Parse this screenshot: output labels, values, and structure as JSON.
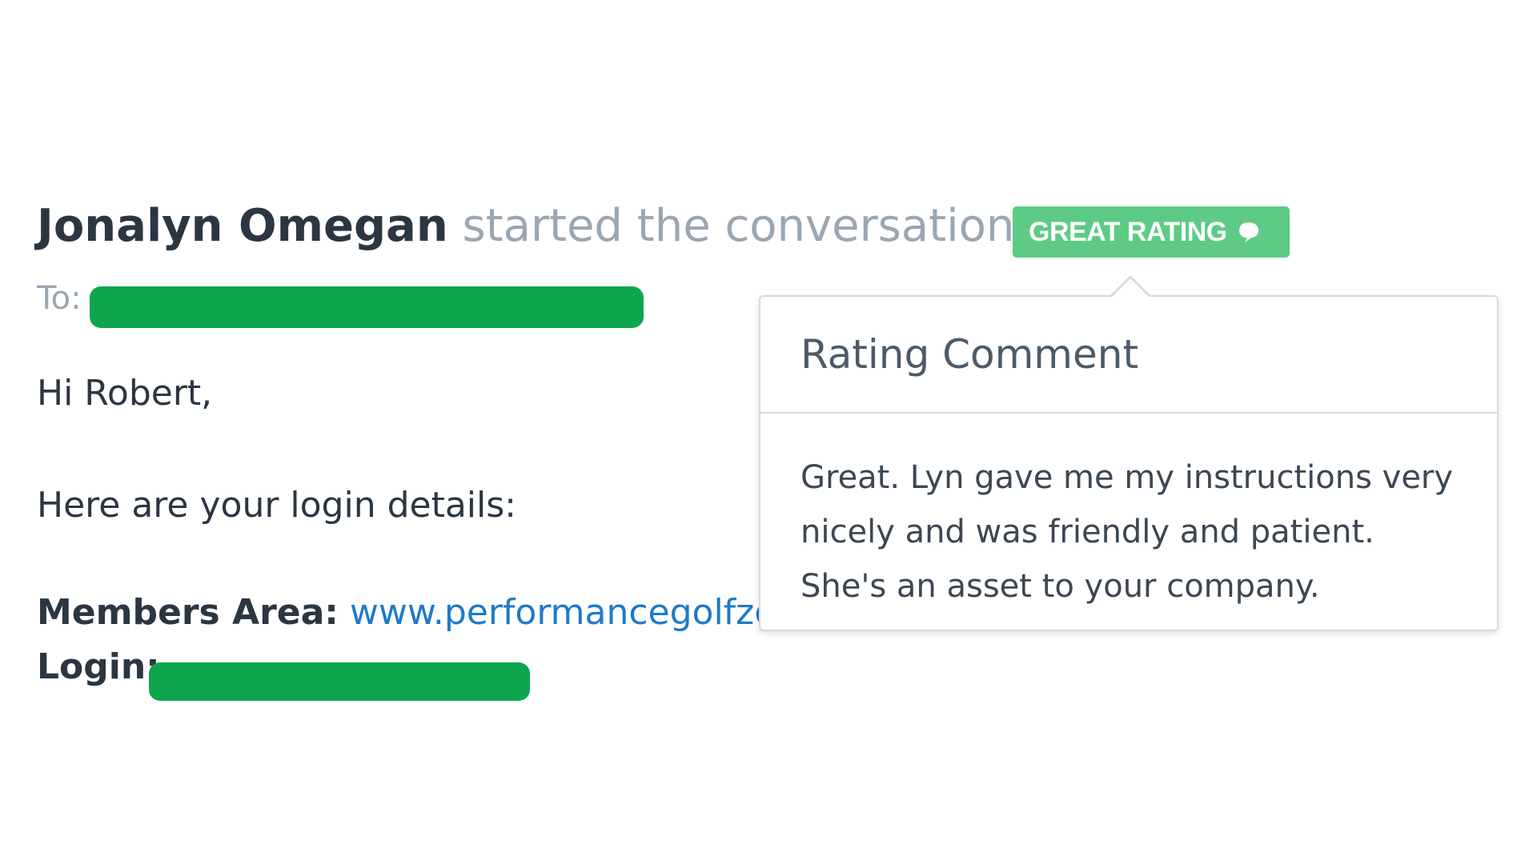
{
  "conversation": {
    "author": "Jonalyn Omegan",
    "action": "started the conversation",
    "badge_label": "GREAT RATING",
    "badge_icon": "speech-bubble-icon",
    "badge_color": "#5dcb86",
    "to_label": "To:"
  },
  "message": {
    "greeting": "Hi Robert,",
    "intro": "Here are your login details:",
    "members_label": "Members Area:",
    "members_link": "www.performancegolfzc",
    "login_label": "Login:"
  },
  "rating_popover": {
    "title": "Rating Comment",
    "lines": [
      "Great. Lyn gave me my instructions very",
      "nicely and was friendly and patient.",
      "She's an asset to your company."
    ]
  },
  "colors": {
    "link": "#1f7ac8",
    "redaction": "#0ea64c"
  }
}
